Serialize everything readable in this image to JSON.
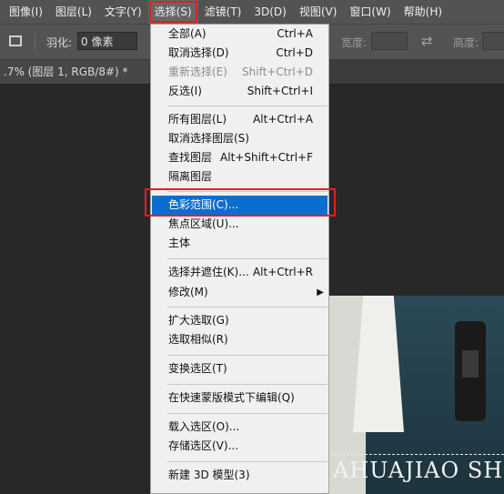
{
  "menubar": {
    "items": [
      {
        "label": "图像(I)"
      },
      {
        "label": "图层(L)"
      },
      {
        "label": "文字(Y)"
      },
      {
        "label": "选择(S)"
      },
      {
        "label": "滤镜(T)"
      },
      {
        "label": "3D(D)"
      },
      {
        "label": "视图(V)"
      },
      {
        "label": "窗口(W)"
      },
      {
        "label": "帮助(H)"
      }
    ]
  },
  "options": {
    "feather_label": "羽化:",
    "feather_value": "0 像素",
    "width_label": "宽度:",
    "height_label": "高度:",
    "swap_icon": "⇄"
  },
  "document": {
    "tab_title": ".7% (图层 1, RGB/8#) *"
  },
  "select_menu": {
    "items": [
      {
        "label": "全部(A)",
        "shortcut": "Ctrl+A"
      },
      {
        "label": "取消选择(D)",
        "shortcut": "Ctrl+D"
      },
      {
        "label": "重新选择(E)",
        "shortcut": "Shift+Ctrl+D"
      },
      {
        "label": "反选(I)",
        "shortcut": "Shift+Ctrl+I"
      },
      {
        "label": "所有图层(L)",
        "shortcut": "Alt+Ctrl+A"
      },
      {
        "label": "取消选择图层(S)",
        "shortcut": ""
      },
      {
        "label": "查找图层",
        "shortcut": "Alt+Shift+Ctrl+F"
      },
      {
        "label": "隔离图层",
        "shortcut": ""
      },
      {
        "label": "色彩范围(C)...",
        "shortcut": ""
      },
      {
        "label": "焦点区域(U)...",
        "shortcut": ""
      },
      {
        "label": "主体",
        "shortcut": ""
      },
      {
        "label": "选择并遮住(K)...",
        "shortcut": "Alt+Ctrl+R"
      },
      {
        "label": "修改(M)",
        "shortcut": "",
        "submenu_arrow": "▶"
      },
      {
        "label": "扩大选取(G)",
        "shortcut": ""
      },
      {
        "label": "选取相似(R)",
        "shortcut": ""
      },
      {
        "label": "变换选区(T)",
        "shortcut": ""
      },
      {
        "label": "在快速蒙版模式下编辑(Q)",
        "shortcut": ""
      },
      {
        "label": "载入选区(O)...",
        "shortcut": ""
      },
      {
        "label": "存储选区(V)...",
        "shortcut": ""
      },
      {
        "label": "新建 3D 模型(3)",
        "shortcut": ""
      }
    ]
  },
  "canvas": {
    "caption_text": "AHUAJIAO SH"
  },
  "colors": {
    "highlight": "#0a6ed1",
    "annotation_red": "#e02020"
  }
}
